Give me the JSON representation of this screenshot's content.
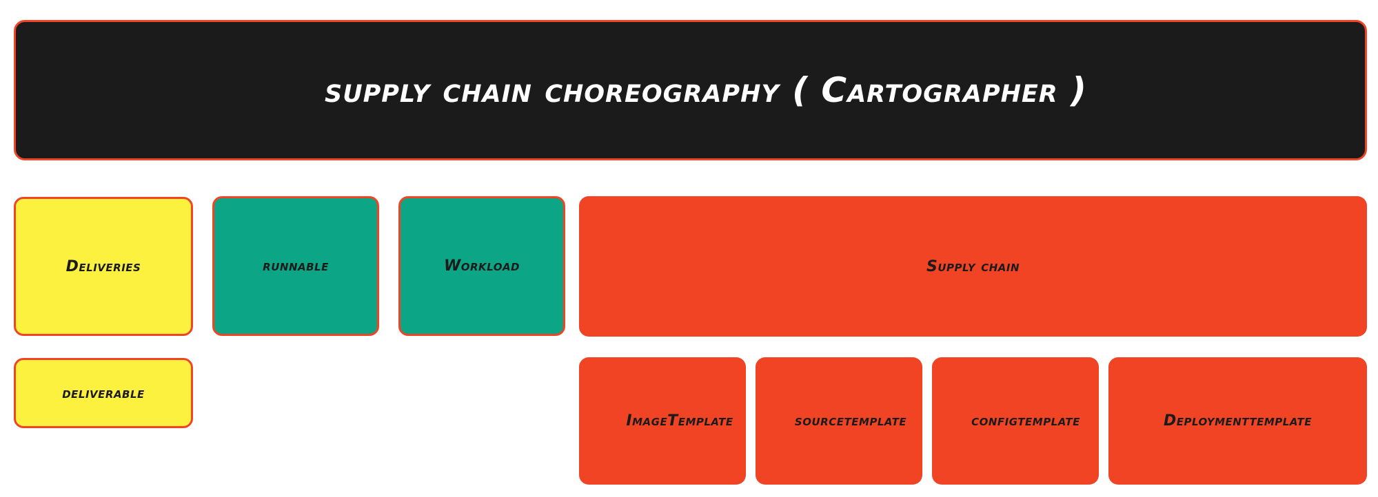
{
  "title": "supply chain choreography ( Cartographer )",
  "boxes": {
    "deliveries": "Deliveries",
    "runnable": "runnable",
    "workload": "Workload",
    "supply_chain": "Supply chain",
    "deliverable": "deliverable",
    "image_template": "ImageTemplate",
    "source_template": "sourcetemplate",
    "config_template": "configtemplate",
    "deployment_template": "Deploymenttemplate"
  },
  "colors": {
    "banner": "#1b1b1b",
    "banner_border": "#f04425",
    "yellow": "#fdf140",
    "green": "#0ca585",
    "red": "#f04425"
  }
}
